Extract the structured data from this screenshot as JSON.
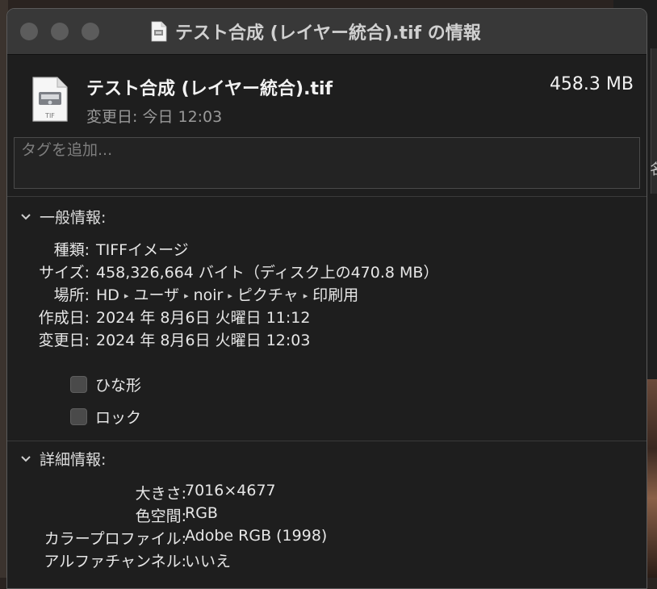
{
  "window": {
    "title": "テスト合成 (レイヤー統合).tif の情報"
  },
  "header": {
    "file_name": "テスト合成 (レイヤー統合).tif",
    "file_size": "458.3 MB",
    "modified": "変更日: 今日 12:03",
    "icon_label": "TIF"
  },
  "tags": {
    "placeholder": "タグを追加..."
  },
  "general": {
    "heading": "一般情報:",
    "kind_label": "種類:",
    "kind_value": "TIFFイメージ",
    "size_label": "サイズ:",
    "size_value": "458,326,664 バイト（ディスク上の470.8 MB）",
    "where_label": "場所:",
    "where_path": [
      "HD",
      "ユーザ",
      "noir",
      "ピクチャ",
      "印刷用"
    ],
    "created_label": "作成日:",
    "created_value": "2024 年 8月6日 火曜日 11:12",
    "modified_label": "変更日:",
    "modified_value": "2024 年 8月6日 火曜日 12:03",
    "stationery_label": "ひな形",
    "locked_label": "ロック",
    "stationery_checked": false,
    "locked_checked": false
  },
  "details": {
    "heading": "詳細情報:",
    "dimensions_label": "大きさ:",
    "dimensions_value": "7016×4677",
    "color_space_label": "色空間:",
    "color_space_value": "RGB",
    "profile_label": "カラープロファイル:",
    "profile_value": "Adobe RGB (1998)",
    "alpha_label": "アルファチャンネル:",
    "alpha_value": "いいえ"
  },
  "background": {
    "peek_char": "名"
  },
  "colors": {
    "window_bg": "#1e1e1e",
    "titlebar_bg": "#383838",
    "text": "#e6e6e6",
    "secondary_text": "#9a9a9a"
  }
}
